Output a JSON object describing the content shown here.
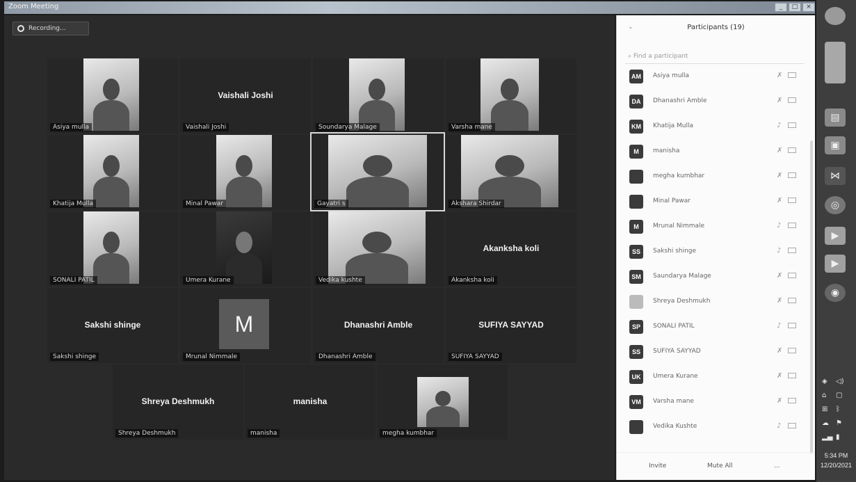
{
  "window": {
    "title": "Zoom Meeting"
  },
  "meeting": {
    "recording_label": "Recording...",
    "tiles": [
      {
        "tag": "Asiya mulla"
      },
      {
        "tag": "Vaishali Joshi",
        "big": "Vaishali Joshi"
      },
      {
        "tag": "Soundarya Malage"
      },
      {
        "tag": "Varsha mane"
      },
      {
        "tag": "Khatija Mulla"
      },
      {
        "tag": "Minal Pawar"
      },
      {
        "tag": "Gayatri s"
      },
      {
        "tag": "Akshara Shirdar"
      },
      {
        "tag": "SONALI PATIL"
      },
      {
        "tag": "Umera Kurane"
      },
      {
        "tag": "Vedika kushte"
      },
      {
        "tag": "Akanksha koli",
        "big": "Akanksha koli"
      },
      {
        "tag": "Sakshi shinge",
        "big": "Sakshi shinge"
      },
      {
        "tag": "Mrunal Nimmale",
        "initial": "M"
      },
      {
        "tag": "Dhanashri Amble",
        "big": "Dhanashri Amble"
      },
      {
        "tag": "SUFIYA SAYYAD",
        "big": "SUFIYA SAYYAD"
      },
      {
        "tag": "Shreya Deshmukh",
        "big": "Shreya Deshmukh"
      },
      {
        "tag": "manisha",
        "big": "manisha"
      },
      {
        "tag": "megha kumbhar"
      }
    ]
  },
  "participants": {
    "title": "Participants (19)",
    "search_placeholder": "Find a participant",
    "list": [
      {
        "initials": "AM",
        "name": "Asiya mulla"
      },
      {
        "initials": "DA",
        "name": "Dhanashri Amble"
      },
      {
        "initials": "KM",
        "name": "Khatija Mulla"
      },
      {
        "initials": "M",
        "name": "manisha"
      },
      {
        "initials": "",
        "name": "megha kumbhar"
      },
      {
        "initials": "",
        "name": "Minal Pawar"
      },
      {
        "initials": "M",
        "name": "Mrunal Nimmale"
      },
      {
        "initials": "SS",
        "name": "Sakshi shinge"
      },
      {
        "initials": "SM",
        "name": "Saundarya Malage"
      },
      {
        "initials": "",
        "name": "Shreya Deshmukh"
      },
      {
        "initials": "SP",
        "name": "SONALI PATIL"
      },
      {
        "initials": "SS",
        "name": "SUFIYA SAYYAD"
      },
      {
        "initials": "UK",
        "name": "Umera Kurane"
      },
      {
        "initials": "VM",
        "name": "Varsha mane"
      },
      {
        "initials": "",
        "name": "Vedika Kushte"
      }
    ],
    "footer": {
      "invite": "Invite",
      "mute_all": "Mute All",
      "more": "..."
    }
  },
  "taskbar": {
    "time": "5:34 PM",
    "date": "12/20/2021"
  },
  "icons": [
    "record-dot-icon",
    "mic-icon",
    "camera-icon",
    "chrome-icon",
    "folder-icon",
    "zoom-icon"
  ]
}
